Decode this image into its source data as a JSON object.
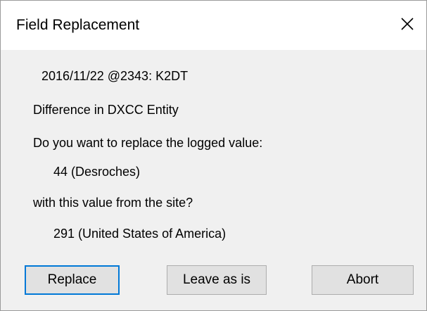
{
  "window": {
    "title": "Field Replacement",
    "close_icon": "close-icon"
  },
  "message": {
    "record_line": "2016/11/22 @2343: K2DT",
    "difference_line": "Difference in DXCC Entity",
    "question_line": "Do you want to replace the logged value:",
    "logged_value": "44 (Desroches)",
    "site_prompt": "with this value from the site?",
    "site_value": "291 (United States of America)"
  },
  "buttons": {
    "replace": "Replace",
    "leave": "Leave as is",
    "abort": "Abort"
  },
  "colors": {
    "dialog_background": "#f0f0f0",
    "titlebar_background": "#ffffff",
    "button_face": "#e1e1e1",
    "default_button_border": "#0078d7"
  }
}
